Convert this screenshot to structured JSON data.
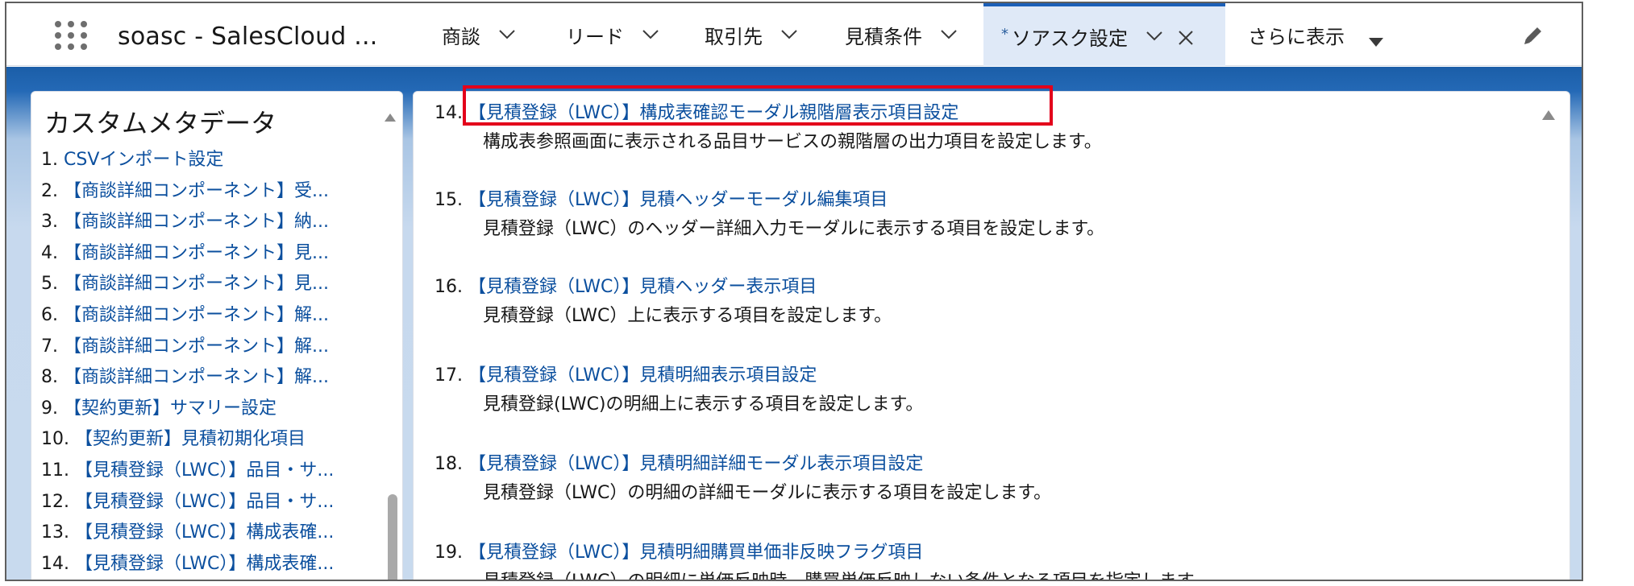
{
  "app": {
    "name": "soasc - SalesCloud ..."
  },
  "tabs": [
    {
      "label": "商談"
    },
    {
      "label": "リード"
    },
    {
      "label": "取引先"
    },
    {
      "label": "見積条件"
    },
    {
      "label": "ソアスク設定",
      "active_marker": "*"
    },
    {
      "label": "さらに表示"
    }
  ],
  "sidebar": {
    "title": "カスタムメタデータ",
    "items": [
      {
        "num": "1.",
        "label": "CSVインポート設定"
      },
      {
        "num": "2.",
        "label": "【商談詳細コンポーネント】受..."
      },
      {
        "num": "3.",
        "label": "【商談詳細コンポーネント】納..."
      },
      {
        "num": "4.",
        "label": "【商談詳細コンポーネント】見..."
      },
      {
        "num": "5.",
        "label": "【商談詳細コンポーネント】見..."
      },
      {
        "num": "6.",
        "label": "【商談詳細コンポーネント】解..."
      },
      {
        "num": "7.",
        "label": "【商談詳細コンポーネント】解..."
      },
      {
        "num": "8.",
        "label": "【商談詳細コンポーネント】解..."
      },
      {
        "num": "9.",
        "label": "【契約更新】サマリー設定"
      },
      {
        "num": "10.",
        "label": "【契約更新】見積初期化項目"
      },
      {
        "num": "11.",
        "label": "【見積登録（LWC）】品目・サ..."
      },
      {
        "num": "12.",
        "label": "【見積登録（LWC）】品目・サ..."
      },
      {
        "num": "13.",
        "label": "【見積登録（LWC）】構成表確..."
      },
      {
        "num": "14.",
        "label": "【見積登録（LWC）】構成表確..."
      }
    ]
  },
  "content": {
    "entries": [
      {
        "num": "14.",
        "title": "【見積登録（LWC）】構成表確認モーダル親階層表示項目設定",
        "desc": "構成表参照画面に表示される品目サービスの親階層の出力項目を設定します。"
      },
      {
        "num": "15.",
        "title": "【見積登録（LWC）】見積ヘッダーモーダル編集項目",
        "desc": "見積登録（LWC）のヘッダー詳細入力モーダルに表示する項目を設定します。"
      },
      {
        "num": "16.",
        "title": "【見積登録（LWC）】見積ヘッダー表示項目",
        "desc": "見積登録（LWC）上に表示する項目を設定します。"
      },
      {
        "num": "17.",
        "title": "【見積登録（LWC）】見積明細表示項目設定",
        "desc": "見積登録(LWC)の明細上に表示する項目を設定します。"
      },
      {
        "num": "18.",
        "title": "【見積登録（LWC）】見積明細詳細モーダル表示項目設定",
        "desc": "見積登録（LWC）の明細の詳細モーダルに表示する項目を設定します。"
      },
      {
        "num": "19.",
        "title": "【見積登録（LWC）】見積明細購買単価非反映フラグ項目",
        "desc": "見積登録（LWC）の明細に単価反映時、購買単価反映しない条件となる項目を指定します。"
      }
    ]
  },
  "colors": {
    "accent": "#1b5fb8",
    "link": "#0b4f9e",
    "highlight": "#e3001b",
    "active_tab_bg": "#dfe9f7"
  },
  "icons": {
    "app_launcher": "waffle-icon",
    "tab_menu": "chevron-down-icon",
    "close": "close-icon",
    "more": "caret-down-icon",
    "edit": "pencil-icon",
    "scroll_up": "scroll-up-icon"
  }
}
